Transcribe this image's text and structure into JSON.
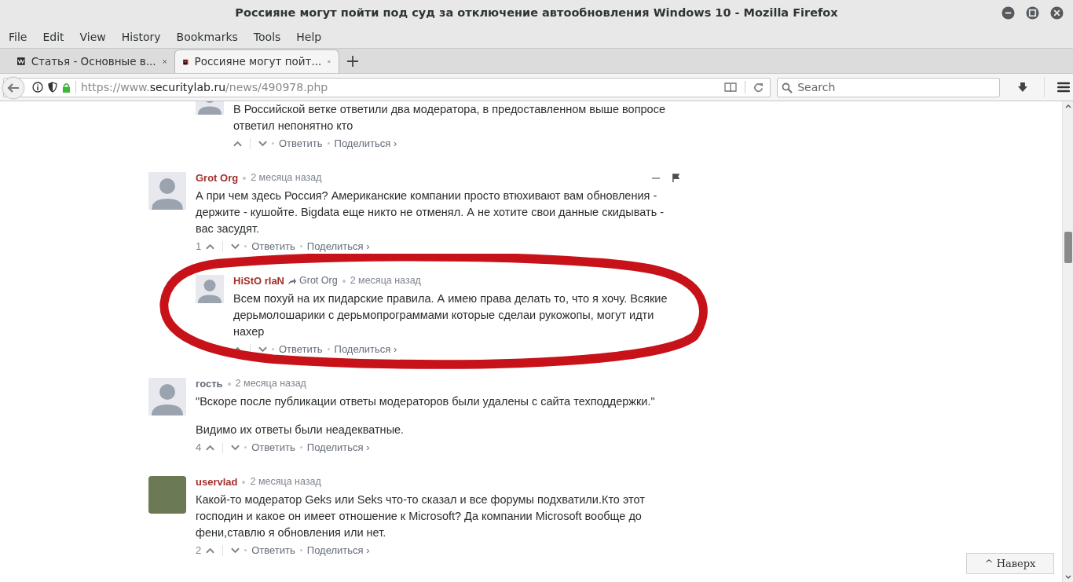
{
  "window": {
    "title": "Россияне могут пойти под суд за отключение автообновления Windows 10 - Mozilla Firefox"
  },
  "menu": [
    "File",
    "Edit",
    "View",
    "History",
    "Bookmarks",
    "Tools",
    "Help"
  ],
  "tabs": [
    {
      "label": "Статья - Основные в...",
      "selected": false,
      "kind": "logo"
    },
    {
      "label": "Россияне могут пойт...",
      "selected": true,
      "kind": "hacker"
    }
  ],
  "address_bar": {
    "scheme": "https://www.",
    "domain": "securitylab.ru",
    "path": "/news/490978.php"
  },
  "search": {
    "placeholder": "Search"
  },
  "comments": [
    {
      "kind": "reply",
      "avatar": {
        "kind": "default"
      },
      "hovered": false,
      "highlighted": false,
      "body": [
        "В Российской ветке ответили два модератора, в предоставленном выше вопросе ответил непонятно кто"
      ],
      "actions": {
        "reply": "Ответить",
        "share": "Поделиться ›"
      }
    },
    {
      "kind": "top",
      "avatar": {
        "kind": "default"
      },
      "author": "Grot Org",
      "color": "#a2302b",
      "time": "2 месяца назад",
      "hovered": true,
      "highlighted": false,
      "body": [
        "А при чем здесь Россия? Американские компании просто втюхивают вам обновления - держите - кушойте. Bigdata еще никто не отменял. А не хотите свои данные скидывать - вас засудят."
      ],
      "votes": "1",
      "actions": {
        "reply": "Ответить",
        "share": "Поделиться ›"
      }
    },
    {
      "kind": "reply",
      "avatar": {
        "kind": "default"
      },
      "author": "HiStO rIaN",
      "color": "#a2302b",
      "reply_to": "Grot Org",
      "time": "2 месяца назад",
      "hovered": false,
      "highlighted": true,
      "body": [
        "Всем похуй на их пидарские правила. А имею права делать то, что я хочу. Всякие дерьмолошарики с дерьмопрограммами которые сделаи рукожопы, могут идти нахер"
      ],
      "actions": {
        "reply": "Ответить",
        "share": "Поделиться ›"
      }
    },
    {
      "kind": "top",
      "avatar": {
        "kind": "default"
      },
      "author": "гость",
      "color": "#656c7a",
      "time": "2 месяца назад",
      "hovered": false,
      "highlighted": false,
      "body": [
        "\"Вскоре после публикации ответы модераторов были удалены с сайта техподдержки.\"",
        "Видимо их ответы были неадекватные."
      ],
      "votes": "4",
      "actions": {
        "reply": "Ответить",
        "share": "Поделиться ›"
      }
    },
    {
      "kind": "top",
      "avatar": {
        "kind": "photo"
      },
      "author": "uservlad",
      "color": "#a2302b",
      "time": "2 месяца назад",
      "hovered": false,
      "highlighted": false,
      "body": [
        "Какой-то модератор Geks или Seks что-то сказал и все форумы подхватили.Кто этот господин и какое он имеет отношение к Microsoft? Да компании Microsoft вообще до фени,ставлю я обновления или нет."
      ],
      "votes": "2",
      "actions": {
        "reply": "Ответить",
        "share": "Поделиться ›"
      }
    }
  ],
  "back_to_top": "^ Наверх"
}
